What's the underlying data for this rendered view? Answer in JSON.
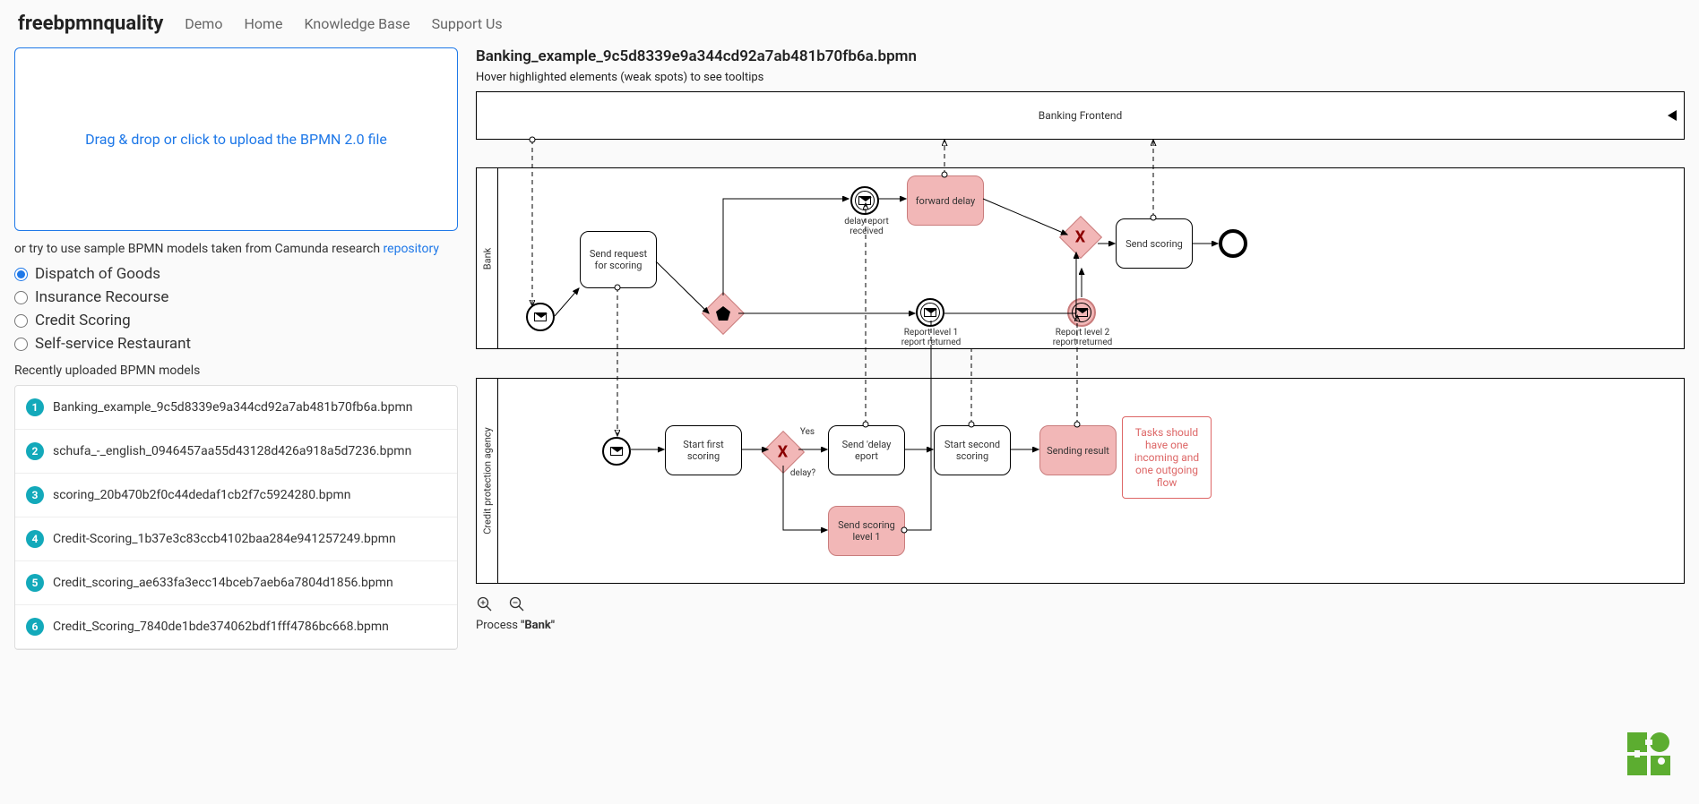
{
  "nav": {
    "brand": "freebpmnquality",
    "links": [
      "Demo",
      "Home",
      "Knowledge Base",
      "Support Us"
    ]
  },
  "dropzone_text": "Drag & drop or click to upload the BPMN 2.0 file",
  "samples_prefix": "or try to use sample BPMN models taken from Camunda research ",
  "samples_link": "repository",
  "sample_radios": [
    "Dispatch of Goods",
    "Insurance Recourse",
    "Credit Scoring",
    "Self-service Restaurant"
  ],
  "recent_label": "Recently uploaded BPMN models",
  "recent": [
    {
      "n": "1",
      "name": "Banking_example_9c5d8339e9a344cd92a7ab481b70fb6a.bpmn"
    },
    {
      "n": "2",
      "name": "schufa_-_english_0946457aa55d43128d426a918a5d7236.bpmn"
    },
    {
      "n": "3",
      "name": "scoring_20b470b2f0c44dedaf1cb2f7c5924280.bpmn"
    },
    {
      "n": "4",
      "name": "Credit-Scoring_1b37e3c83ccb4102baa284e941257249.bpmn"
    },
    {
      "n": "5",
      "name": "Credit_scoring_ae633fa3ecc14bceb7aeb6a7804d1856.bpmn"
    },
    {
      "n": "6",
      "name": "Credit_Scoring_7840de1bde374062bdf1fff4786bc668.bpmn"
    }
  ],
  "file_title": "Banking_example_9c5d8339e9a344cd92a7ab481b70fb6a.bpmn",
  "hover_hint": "Hover highlighted elements (weak spots) to see tooltips",
  "pools": {
    "frontend": "Banking Frontend",
    "bank": "Bank",
    "agency": "Credit protection agency"
  },
  "tasks": {
    "send_request": "Send request for scoring",
    "forward_delay": "forward delay",
    "send_scoring": "Send scoring",
    "start_first": "Start first scoring",
    "send_delay_report": "Send 'delay eport",
    "start_second": "Start second scoring",
    "sending_result": "Sending result",
    "send_level1": "Send scoring level 1"
  },
  "labels": {
    "delay_received": "delay eport received",
    "report_level1": "Report level 1 report returned",
    "report_level2": "Report level 2 report returned",
    "yes": "Yes",
    "delay_q": "delay?"
  },
  "tooltip": "Tasks should have one incoming and one outgoing flow",
  "process_line_prefix": "Process ",
  "process_line_name": "\"Bank\""
}
